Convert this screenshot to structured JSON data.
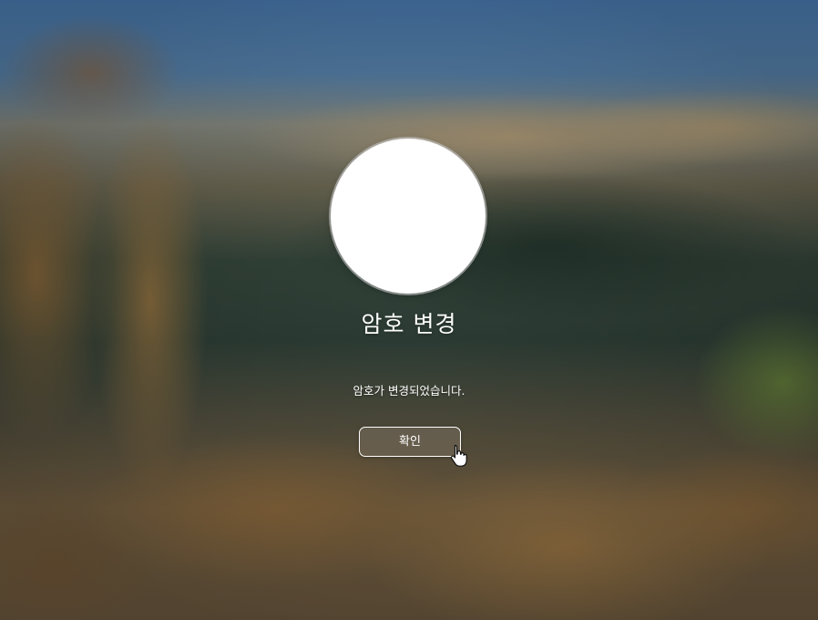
{
  "dialog": {
    "title": "암호 변경",
    "message": "암호가 변경되었습니다.",
    "confirm_label": "확인"
  },
  "icons": {
    "avatar": "user-avatar",
    "cursor": "hand-pointer-cursor-icon"
  },
  "colors": {
    "text": "#ffffff",
    "avatar": "#ffffff"
  }
}
